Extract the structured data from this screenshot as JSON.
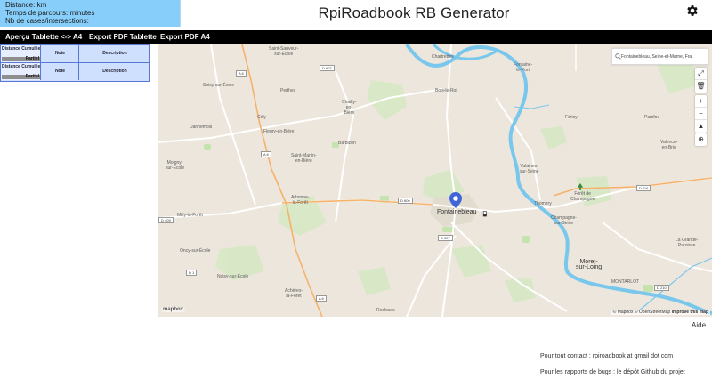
{
  "info": {
    "distance": "Distance: km",
    "time": "Temps de parcours: minutes",
    "cells": "Nb de cases/intersections:"
  },
  "header": {
    "title": "RpiRoadbook RB Generator",
    "settings_icon": "gear-icon"
  },
  "nav": {
    "preview": "Aperçu Tablette <-> A4",
    "export_tablet": "Export PDF Tablette",
    "export_a4": "Export PDF A4"
  },
  "roadbook": {
    "rows": [
      {
        "distance_label": "Distance Cumulée",
        "partial_label": "Partiel",
        "note_label": "Note",
        "description_label": "Description"
      },
      {
        "distance_label": "Distance Cumulée",
        "partial_label": "Partiel",
        "note_label": "Note",
        "description_label": "Description"
      }
    ]
  },
  "map": {
    "search_value": "Fontainebleau, Seine-et-Marne, Fra",
    "controls": [
      "expand-icon",
      "trash-icon",
      "zoom-in-icon",
      "zoom-out-icon",
      "compass-icon",
      "locate-icon"
    ],
    "logo": "mapbox",
    "attribution": "© Mapbox © OpenStreetMap",
    "attribution_link": "Improve this map",
    "places": {
      "saint_sauveur": "Saint-Sauveur-\nsur-École",
      "chartrettes": "Chartrettes",
      "fontaine_le_port": "Fontaine-\nle-Port",
      "soisy": "Soisy-sur-École",
      "perthes": "Perthes",
      "bois_le_roi": "Bois-le-Roi",
      "chailly": "Chailly-\nen-\nBière",
      "fericy": "Féricy",
      "pamfou": "Pamfou",
      "cely": "Cély",
      "dannemois": "Dannemois",
      "fleury": "Fleury-en-Bière",
      "barbizon": "Barbizon",
      "valence": "Valence-\nen-Brie",
      "moigny": "Moigny-\nsur-École",
      "saint_martin": "Saint-Martin-\nen-Bière",
      "vulaines": "Vulaines-\nsur-Seine",
      "foret_champagne": "Forêt de\nChampagne",
      "arbonne": "Arbonne-\nla-Forêt",
      "fontainebleau": "Fontainebleau",
      "thomery": "Thomery",
      "milly": "Milly-la-Forêt",
      "champagne": "Champagne-\nsur-Seine",
      "grande_paroisse": "La Grande-\nParoisse",
      "oncy": "Oncy-sur-École",
      "moret": "Moret-\nsur-Loing",
      "noisy": "Noisy-sur-École",
      "montarlot": "MONTARLOT",
      "acheres": "Achères-\nla-Forêt",
      "recloses": "Recloses"
    },
    "road_shields": {
      "a6_1": "A 6",
      "a6_2": "A 6",
      "a6_3": "A 6",
      "d607_1": "D 607",
      "d607_2": "D 607",
      "d409": "D 409",
      "d606": "D 606",
      "d210": "D 210",
      "d116": "D 116",
      "d1": "D 1"
    }
  },
  "footer": {
    "help": "Aide",
    "contact": "Pour tout contact : rpiroadbook at gmail dot com",
    "bugs_prefix": "Pour les rapports de bugs : ",
    "bugs_link": "le dépôt Github du projet"
  }
}
